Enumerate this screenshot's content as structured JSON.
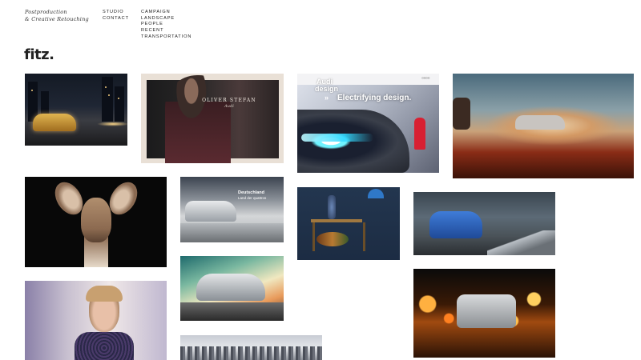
{
  "header": {
    "tagline": [
      "Postproduction",
      "& Creative Retouching"
    ],
    "nav_primary": [
      "STUDIO",
      "CONTACT"
    ],
    "nav_secondary": [
      "CAMPAIGN",
      "LANDSCAPE",
      "PEOPLE",
      "RECENT",
      "TRANSPORTATION"
    ],
    "logo": "fitz."
  },
  "tiles": {
    "oliver": {
      "name": "OLIVER STEFAN",
      "sub": "Audi"
    },
    "audi": {
      "brand_line1": "Audi",
      "brand_line2": "design",
      "headline": "Electrifying design.",
      "arrow": "»"
    },
    "wet_road": {
      "line1": "Deutschland",
      "line2": "Land der quattros"
    }
  }
}
